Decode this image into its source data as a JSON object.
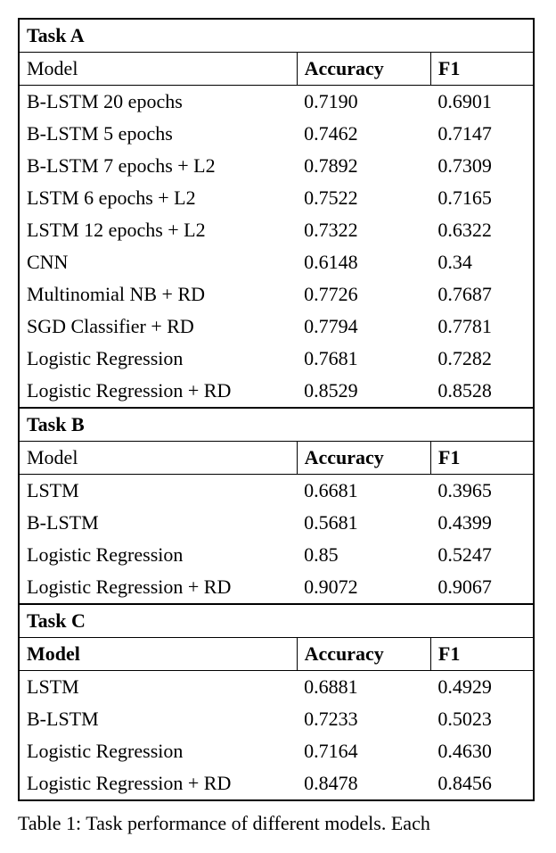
{
  "chart_data": [
    {
      "type": "table",
      "title": "Task A",
      "columns": [
        "Model",
        "Accuracy",
        "F1"
      ],
      "rows": [
        {
          "model": "B-LSTM 20 epochs",
          "accuracy": "0.7190",
          "f1": "0.6901"
        },
        {
          "model": "B-LSTM 5 epochs",
          "accuracy": "0.7462",
          "f1": "0.7147"
        },
        {
          "model": "B-LSTM 7 epochs + L2",
          "accuracy": "0.7892",
          "f1": "0.7309"
        },
        {
          "model": "LSTM 6 epochs + L2",
          "accuracy": "0.7522",
          "f1": "0.7165"
        },
        {
          "model": "LSTM 12 epochs + L2",
          "accuracy": "0.7322",
          "f1": "0.6322"
        },
        {
          "model": "CNN",
          "accuracy": "0.6148",
          "f1": "0.34"
        },
        {
          "model": "Multinomial NB + RD",
          "accuracy": "0.7726",
          "f1": "0.7687"
        },
        {
          "model": "SGD Classifier + RD",
          "accuracy": "0.7794",
          "f1": "0.7781"
        },
        {
          "model": "Logistic Regression",
          "accuracy": "0.7681",
          "f1": "0.7282"
        },
        {
          "model": "Logistic Regression + RD",
          "accuracy": "0.8529",
          "f1": "0.8528"
        }
      ]
    },
    {
      "type": "table",
      "title": "Task B",
      "columns": [
        "Model",
        "Accuracy",
        "F1"
      ],
      "rows": [
        {
          "model": "LSTM",
          "accuracy": "0.6681",
          "f1": "0.3965"
        },
        {
          "model": "B-LSTM",
          "accuracy": "0.5681",
          "f1": "0.4399"
        },
        {
          "model": "Logistic Regression",
          "accuracy": "0.85",
          "f1": "0.5247"
        },
        {
          "model": "Logistic Regression + RD",
          "accuracy": "0.9072",
          "f1": "0.9067"
        }
      ]
    },
    {
      "type": "table",
      "title": "Task C",
      "columns": [
        "Model",
        "Accuracy",
        "F1"
      ],
      "columns_bold": [
        true,
        true,
        true
      ],
      "rows": [
        {
          "model": "LSTM",
          "accuracy": "0.6881",
          "f1": "0.4929"
        },
        {
          "model": "B-LSTM",
          "accuracy": "0.7233",
          "f1": "0.5023"
        },
        {
          "model": "Logistic Regression",
          "accuracy": "0.7164",
          "f1": "0.4630"
        },
        {
          "model": "Logistic Regression + RD",
          "accuracy": "0.8478",
          "f1": "0.8456"
        }
      ]
    }
  ],
  "caption_prefix": "Table 1: Task performance of different models.",
  "caption_trail": "Each"
}
